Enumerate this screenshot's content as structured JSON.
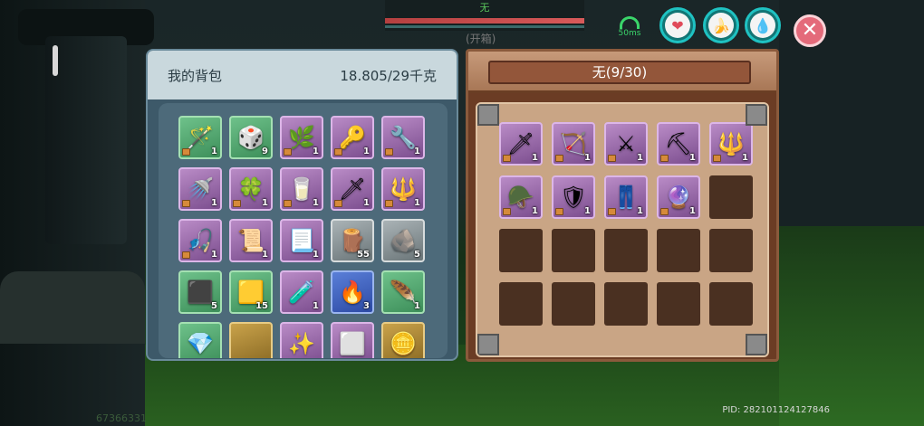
{
  "hud": {
    "target_name": "无",
    "chest_status": "(开箱)",
    "ping": "50ms",
    "status_icons": [
      {
        "name": "heart-icon",
        "glyph": "❤"
      },
      {
        "name": "stomach-icon",
        "glyph": "🍌"
      },
      {
        "name": "water-drop-icon",
        "glyph": "💧"
      }
    ],
    "close_glyph": "✕"
  },
  "backpack": {
    "title": "我的背包",
    "weight": "18.805/29千克",
    "items": [
      {
        "name": "magic-wand",
        "glyph": "🪄",
        "rarity": "green",
        "count": "1",
        "locked": true
      },
      {
        "name": "dice",
        "glyph": "🎲",
        "rarity": "green",
        "count": "9",
        "locked": false
      },
      {
        "name": "green-blade",
        "glyph": "🌿",
        "rarity": "purple",
        "count": "1",
        "locked": true
      },
      {
        "name": "brass-key",
        "glyph": "🔑",
        "rarity": "purple",
        "count": "1",
        "locked": true
      },
      {
        "name": "staff",
        "glyph": "🔧",
        "rarity": "purple",
        "count": "1",
        "locked": true
      },
      {
        "name": "watering-can",
        "glyph": "🚿",
        "rarity": "purple",
        "count": "1",
        "locked": true
      },
      {
        "name": "clover",
        "glyph": "🍀",
        "rarity": "purple",
        "count": "1",
        "locked": true
      },
      {
        "name": "milk-carton",
        "glyph": "🥛",
        "rarity": "purple",
        "count": "1",
        "locked": true
      },
      {
        "name": "red-scepter",
        "glyph": "🗡",
        "rarity": "purple",
        "count": "1",
        "locked": true
      },
      {
        "name": "spear",
        "glyph": "🔱",
        "rarity": "purple",
        "count": "1",
        "locked": true
      },
      {
        "name": "fishing-rod",
        "glyph": "🎣",
        "rarity": "purple",
        "count": "1",
        "locked": true
      },
      {
        "name": "paper",
        "glyph": "📜",
        "rarity": "purple",
        "count": "1",
        "locked": false
      },
      {
        "name": "scroll",
        "glyph": "📃",
        "rarity": "purple",
        "count": "1",
        "locked": false
      },
      {
        "name": "wood-log",
        "glyph": "🪵",
        "rarity": "gray",
        "count": "55",
        "locked": false
      },
      {
        "name": "copper-ore",
        "glyph": "🪨",
        "rarity": "gray",
        "count": "5",
        "locked": false
      },
      {
        "name": "coal",
        "glyph": "⬛",
        "rarity": "green",
        "count": "5",
        "locked": false
      },
      {
        "name": "gold-ore",
        "glyph": "🟨",
        "rarity": "green",
        "count": "15",
        "locked": false
      },
      {
        "name": "blue-potion",
        "glyph": "🧪",
        "rarity": "purple",
        "count": "1",
        "locked": false
      },
      {
        "name": "fire-crystal",
        "glyph": "🔥",
        "rarity": "blue",
        "count": "3",
        "locked": false
      },
      {
        "name": "feather",
        "glyph": "🪶",
        "rarity": "green",
        "count": "1",
        "locked": false
      },
      {
        "name": "crystal-shard",
        "glyph": "💎",
        "rarity": "green",
        "count": "",
        "locked": false
      },
      {
        "name": "item-partial-2",
        "glyph": "",
        "rarity": "gold",
        "count": "",
        "locked": false
      },
      {
        "name": "item-partial-3",
        "glyph": "✨",
        "rarity": "purple",
        "count": "",
        "locked": false
      },
      {
        "name": "item-partial-4",
        "glyph": "⬜",
        "rarity": "purple",
        "count": "",
        "locked": false
      },
      {
        "name": "gold-coin",
        "glyph": "🪙",
        "rarity": "gold",
        "count": "",
        "locked": false
      }
    ]
  },
  "chest": {
    "title": "无(9/30)",
    "items": [
      {
        "name": "dagger",
        "glyph": "🗡",
        "rarity": "purple",
        "count": "1",
        "locked": true
      },
      {
        "name": "bow",
        "glyph": "🏹",
        "rarity": "purple",
        "count": "1",
        "locked": true
      },
      {
        "name": "broadsword",
        "glyph": "⚔",
        "rarity": "purple",
        "count": "1",
        "locked": true
      },
      {
        "name": "pickaxe",
        "glyph": "⛏",
        "rarity": "purple",
        "count": "1",
        "locked": true
      },
      {
        "name": "crystal-spear",
        "glyph": "🔱",
        "rarity": "purple",
        "count": "1",
        "locked": true
      },
      {
        "name": "dragon-helmet",
        "glyph": "🪖",
        "rarity": "purple",
        "count": "1",
        "locked": true
      },
      {
        "name": "dragon-armor",
        "glyph": "🛡",
        "rarity": "purple",
        "count": "1",
        "locked": true
      },
      {
        "name": "dragon-leggings",
        "glyph": "👖",
        "rarity": "purple",
        "count": "1",
        "locked": true
      },
      {
        "name": "ornate-mirror",
        "glyph": "🔮",
        "rarity": "purple",
        "count": "1",
        "locked": true
      },
      {
        "name": "empty",
        "rarity": "empty"
      },
      {
        "name": "empty",
        "rarity": "empty"
      },
      {
        "name": "empty",
        "rarity": "empty"
      },
      {
        "name": "empty",
        "rarity": "empty"
      },
      {
        "name": "empty",
        "rarity": "empty"
      },
      {
        "name": "empty",
        "rarity": "empty"
      },
      {
        "name": "empty",
        "rarity": "empty"
      },
      {
        "name": "empty",
        "rarity": "empty"
      },
      {
        "name": "empty",
        "rarity": "empty"
      },
      {
        "name": "empty",
        "rarity": "empty"
      },
      {
        "name": "empty",
        "rarity": "empty"
      }
    ]
  },
  "footer": {
    "pid": "PID: 282101124127846",
    "uid": "67366331"
  }
}
